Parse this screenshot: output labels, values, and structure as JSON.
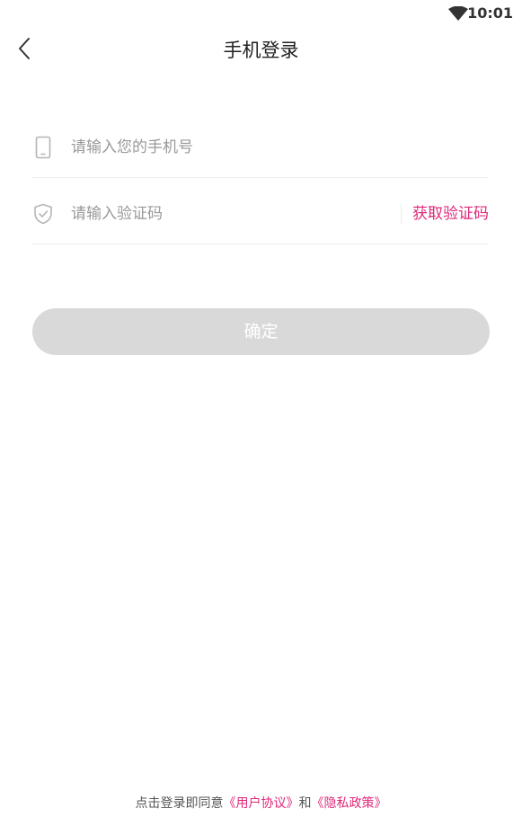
{
  "status_bar": {
    "time": "10:01",
    "wifi_icon": "wifi-icon"
  },
  "header": {
    "back_icon": "chevron-left-icon",
    "title": "手机登录"
  },
  "form": {
    "phone": {
      "icon": "phone-icon",
      "value": "",
      "placeholder": "请输入您的手机号"
    },
    "code": {
      "icon": "shield-check-icon",
      "value": "",
      "placeholder": "请输入验证码",
      "get_code_label": "获取验证码"
    },
    "confirm_label": "确定"
  },
  "footer": {
    "prefix": "点击登录即同意",
    "user_agreement": "《用户协议》",
    "conjunction": "和",
    "privacy_policy": "《隐私政策》"
  },
  "colors": {
    "accent": "#e0287a",
    "button_disabled": "#d9d9d9",
    "placeholder": "#999999",
    "divider": "#efefef"
  }
}
